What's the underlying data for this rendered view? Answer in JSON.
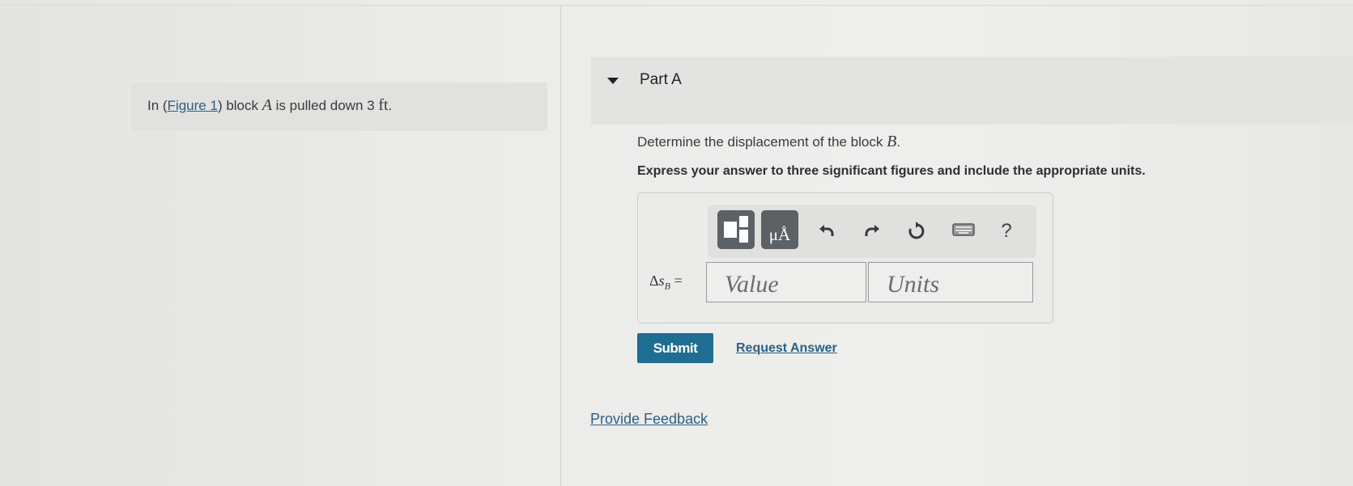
{
  "problem": {
    "prefix": "In (",
    "figure_link": "Figure 1",
    "middle": ") block ",
    "block_var": "A",
    "suffix": " is pulled down 3 ",
    "unit": "ft",
    "end": "."
  },
  "part": {
    "title": "Part A"
  },
  "question": {
    "text": "Determine the displacement of the block ",
    "block_var": "B",
    "end": "."
  },
  "instruction": "Express your answer to three significant figures and include the appropriate units.",
  "toolbar": {
    "units_glyph": "μÅ",
    "help_glyph": "?",
    "icons": [
      "templates-icon",
      "units-icon",
      "undo-icon",
      "redo-icon",
      "reset-icon",
      "keyboard-icon",
      "help-icon"
    ]
  },
  "answer": {
    "label_delta": "Δ",
    "label_var": "s",
    "label_sub": "B",
    "label_eq": " =",
    "value_placeholder": "Value",
    "units_placeholder": "Units"
  },
  "actions": {
    "submit": "Submit",
    "request_answer": "Request Answer",
    "feedback": "Provide Feedback"
  },
  "colors": {
    "accent": "#1e6d92",
    "link": "#2d5f86"
  }
}
